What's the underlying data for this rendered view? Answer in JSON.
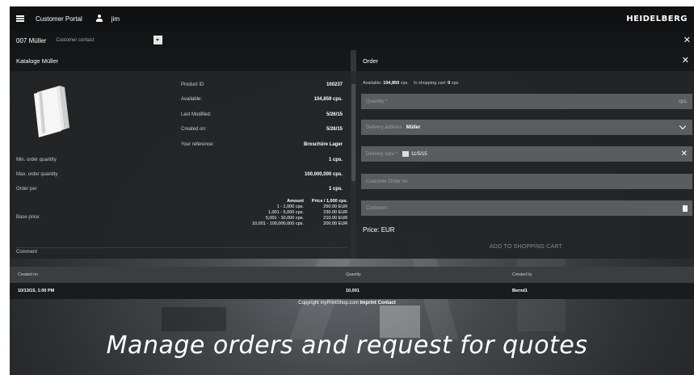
{
  "topbar": {
    "portal_title": "Customer Portal",
    "user_name": "jim",
    "logo_text": "HEIDELBERG"
  },
  "subbar": {
    "customer_name": "007 Müller",
    "customer_contact": "Customer contact"
  },
  "catalog": {
    "title": "Kataloge Müller",
    "details": [
      {
        "label": "Product ID",
        "value": "100237"
      },
      {
        "label": "Available:",
        "value": "104,859 cps."
      },
      {
        "label": "Last Modified:",
        "value": "5/26/15"
      },
      {
        "label": "Created on:",
        "value": "5/26/15"
      },
      {
        "label": "Your reference:",
        "value": "Broschüre Lager"
      }
    ],
    "order_rules": [
      {
        "label": "Min. order quantity",
        "value": "1 cps."
      },
      {
        "label": "Max. order quantity",
        "value": "100,000,000 cps."
      },
      {
        "label": "Order per",
        "value": "1 cps."
      }
    ],
    "base_price_label": "Base price:",
    "price_table": {
      "headers": [
        "Amount",
        "Price / 1,000 cps."
      ],
      "rows": [
        [
          "1 - 1,000 cps.",
          "250.00 EUR"
        ],
        [
          "1,001 - 5,000 cps.",
          "230.00 EUR"
        ],
        [
          "5,001 - 10,000 cps.",
          "210.00 EUR"
        ],
        [
          "10,001 - 100,000,000 cps.",
          "200.00 EUR"
        ]
      ]
    },
    "comment_label": "Comment"
  },
  "order": {
    "title": "Order",
    "available_label": "Available:",
    "available_value": "104,859",
    "available_unit": "cps.",
    "in_cart_label": "In shopping cart:",
    "in_cart_value": "0",
    "in_cart_unit": "cps.",
    "quantity_placeholder": "Quantity *",
    "quantity_unit": "cps.",
    "delivery_address_label": "Delivery address",
    "delivery_address_value": "Müller",
    "delivery_date_label": "Delivery date *",
    "delivery_date_value": "11/5/15",
    "customer_order_placeholder": "Customer Order no.",
    "comment_placeholder": "Comment",
    "price_label": "Price:",
    "price_currency": "EUR",
    "add_to_cart_label": "ADD TO SHOPPING CART"
  },
  "history": {
    "headers": [
      "Created on",
      "Quantity",
      "Created by"
    ],
    "rows": [
      [
        "10/13/15, 1:00 PM",
        "10,001",
        "Bernd1"
      ]
    ]
  },
  "footer": {
    "copyright": "Copyright myPrintShop.com",
    "imprint": "Imprint",
    "contact": "Contact"
  },
  "caption": "Manage orders and request for quotes",
  "colors": {
    "bar_dark": "#101112",
    "panel": "#222426",
    "field": "#5a5c5f"
  }
}
